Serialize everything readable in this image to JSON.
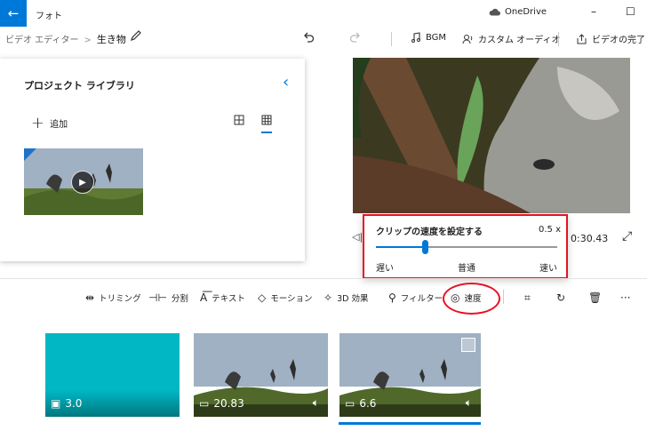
{
  "window": {
    "app_title": "フォト",
    "onedrive": "OneDrive",
    "minimize_glyph": "–",
    "maximize_glyph": "☐",
    "back_glyph": "←"
  },
  "breadcrumb": {
    "parent": "ビデオ エディター",
    "separator": ">",
    "current": "生き物"
  },
  "toolbar": {
    "bgm": "BGM",
    "custom_audio": "カスタム オーディオ",
    "finish_video": "ビデオの完了"
  },
  "library": {
    "title": "プロジェクト ライブラリ",
    "add": "追加"
  },
  "player": {
    "time": "0:30.43"
  },
  "speed_popup": {
    "title": "クリップの速度を設定する",
    "value": "0.5 x",
    "slow": "遅い",
    "normal": "普通",
    "fast": "速い",
    "slider_level": 0.27
  },
  "edit_toolbar": {
    "trim": "トリミング",
    "split": "分割",
    "text": "テキスト",
    "motion": "モーション",
    "effects_3d": "3D 効果",
    "filter": "フィルター",
    "speed": "速度"
  },
  "timeline": {
    "clips": [
      {
        "duration": "3.0",
        "kind": "image"
      },
      {
        "duration": "20.83",
        "kind": "video"
      },
      {
        "duration": "6.6",
        "kind": "video"
      }
    ]
  },
  "colors": {
    "accent": "#0078d7",
    "highlight": "#e81123",
    "title_card": "#00b7c3"
  }
}
